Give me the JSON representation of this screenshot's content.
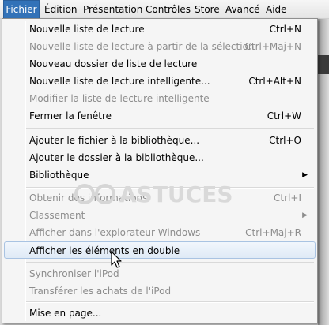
{
  "menubar": {
    "items": [
      "Fichier",
      "Édition",
      "Présentation",
      "Contrôles",
      "Store",
      "Avancé",
      "Aide"
    ]
  },
  "menu": {
    "items": [
      {
        "label": "Nouvelle liste de lecture",
        "shortcut": "Ctrl+N",
        "disabled": false
      },
      {
        "label": "Nouvelle liste de lecture à partir de la sélection",
        "shortcut": "Ctrl+Maj+N",
        "disabled": true
      },
      {
        "label": "Nouveau dossier de liste de lecture",
        "shortcut": "",
        "disabled": false
      },
      {
        "label": "Nouvelle liste de lecture intelligente...",
        "shortcut": "Ctrl+Alt+N",
        "disabled": false
      },
      {
        "label": "Modifier la liste de lecture intelligente",
        "shortcut": "",
        "disabled": true
      },
      {
        "label": "Fermer la fenêtre",
        "shortcut": "Ctrl+W",
        "disabled": false
      },
      {
        "label": "Ajouter le fichier à la bibliothèque...",
        "shortcut": "Ctrl+O",
        "disabled": false
      },
      {
        "label": "Ajouter le dossier à la bibliothèque...",
        "shortcut": "",
        "disabled": false
      },
      {
        "label": "Bibliothèque",
        "shortcut": "",
        "disabled": false,
        "submenu": true
      },
      {
        "label": "Obtenir des informations",
        "shortcut": "Ctrl+I",
        "disabled": true
      },
      {
        "label": "Classement",
        "shortcut": "",
        "disabled": true,
        "submenu": true
      },
      {
        "label": "Afficher dans l'explorateur Windows",
        "shortcut": "Ctrl+Maj+R",
        "disabled": true
      },
      {
        "label": "Afficher les éléments en double",
        "shortcut": "",
        "disabled": false,
        "hover": true
      },
      {
        "label": "Synchroniser l'iPod",
        "shortcut": "",
        "disabled": true
      },
      {
        "label": "Transférer les achats de l'iPod",
        "shortcut": "",
        "disabled": true
      },
      {
        "label": "Mise en page...",
        "shortcut": "",
        "disabled": false
      }
    ]
  },
  "watermark": {
    "text": "ASTUCES"
  },
  "colors": {
    "accent": "#3272b8",
    "disabled": "#8d8d8d",
    "hover_border": "#a9c3e2"
  },
  "icons": {
    "submenu_arrow": "triangle-right-icon",
    "cursor": "mouse-pointer-icon"
  }
}
